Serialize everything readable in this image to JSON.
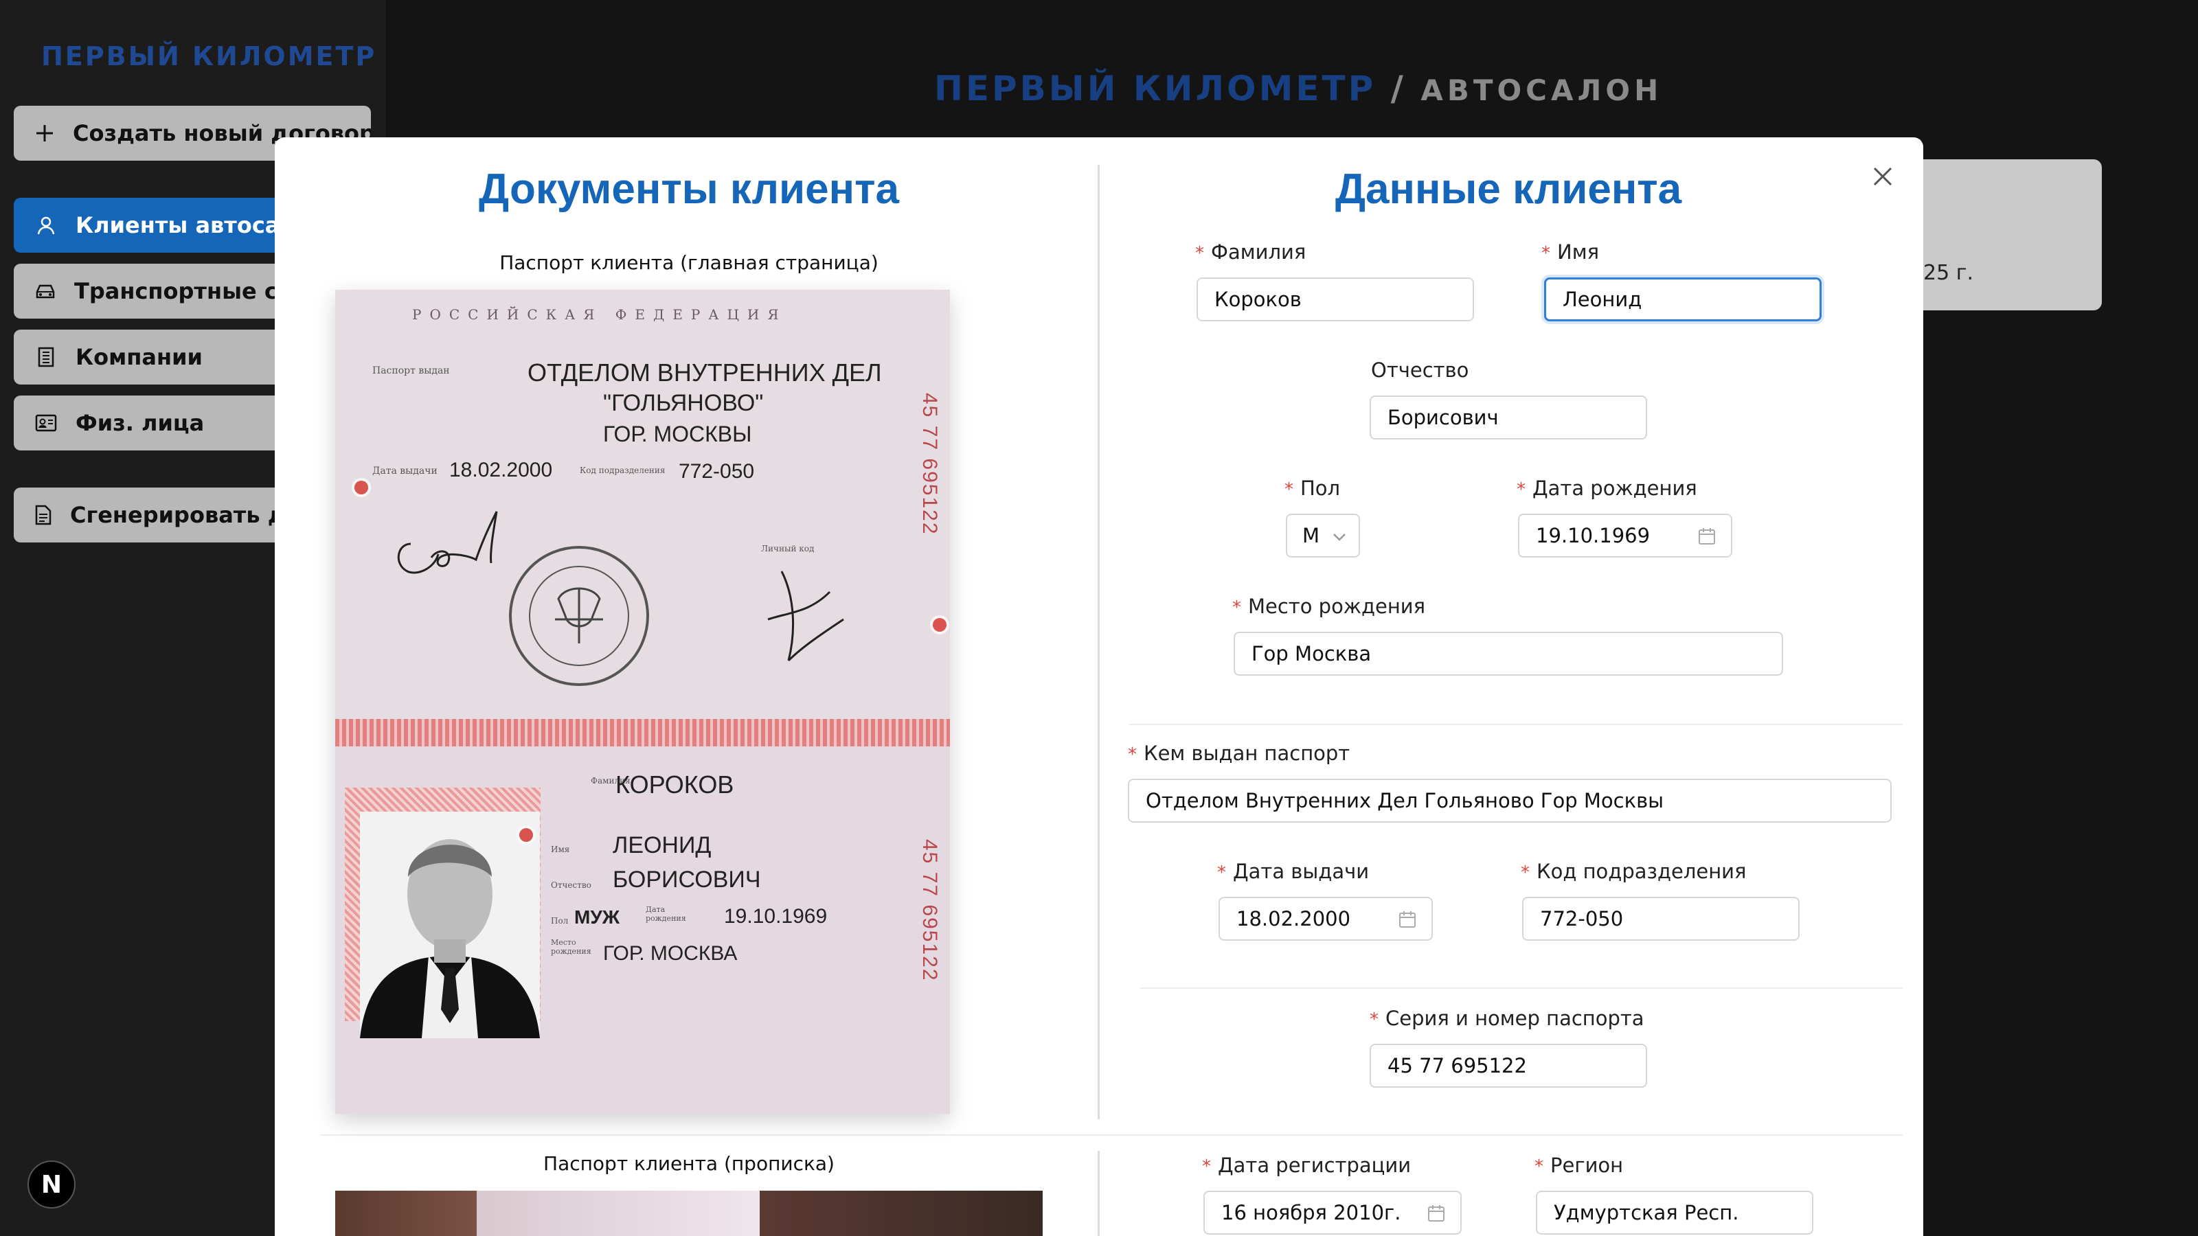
{
  "app": {
    "logo": "ПЕРВЫЙ КИЛОМЕТР",
    "header_left": "ПЕРВЫЙ КИЛОМЕТР",
    "header_sep": " / ",
    "header_right": "АВТОСАЛОН",
    "next_badge": "N",
    "bg_card_text": "25 г."
  },
  "sidebar": {
    "create_button": "Создать новый договор",
    "items": [
      {
        "label": "Клиенты автосалона",
        "icon": "user-icon",
        "active": true
      },
      {
        "label": "Транспортные средства",
        "icon": "car-icon"
      },
      {
        "label": "Компании",
        "icon": "building-icon"
      },
      {
        "label": "Физ. лица",
        "icon": "id-card-icon"
      }
    ],
    "generate_button": "Сгенерировать договор"
  },
  "modal": {
    "documents_title": "Документы клиента",
    "data_title": "Данные клиента",
    "passport_main_caption": "Паспорт клиента (главная страница)",
    "passport_reg_caption": "Паспорт клиента (прописка)"
  },
  "passport_image": {
    "country": "РОССИЙСКАЯ ФЕДЕРАЦИЯ",
    "issued_by_label": "Паспорт выдан",
    "issued_by_1": "ОТДЕЛОМ ВНУТРЕННИХ ДЕЛ",
    "issued_by_2": "\"ГОЛЬЯНОВО\"",
    "issued_by_3": "ГОР. МОСКВЫ",
    "issue_date_label": "Дата выдачи",
    "issue_date": "18.02.2000",
    "code_label": "Код подразделения",
    "code": "772-050",
    "signature_label": "Личный код",
    "surname_label": "Фамилия",
    "surname": "КОРОКОВ",
    "name_label": "Имя",
    "name": "ЛЕОНИД",
    "patronymic_label": "Отчество",
    "patronymic": "БОРИСОВИЧ",
    "sex_label": "Пол",
    "sex": "МУЖ",
    "birth_label": "Дата рождения",
    "birth_date": "19.10.1969",
    "place_label": "Место рождения",
    "place": "ГОР. МОСКВА",
    "series_number": "45 77 695122"
  },
  "form": {
    "surname": {
      "label": "Фамилия",
      "value": "Короков"
    },
    "name": {
      "label": "Имя",
      "value": "Леонид"
    },
    "patronymic": {
      "label": "Отчество",
      "value": "Борисович"
    },
    "sex": {
      "label": "Пол",
      "value": "М"
    },
    "birth_date": {
      "label": "Дата рождения",
      "value": "19.10.1969"
    },
    "birth_place": {
      "label": "Место рождения",
      "value": "Гор Москва"
    },
    "issued_by": {
      "label": "Кем выдан паспорт",
      "value": "Отделом Внутренних Дел Гольяново Гор Москвы"
    },
    "issue_date": {
      "label": "Дата выдачи",
      "value": "18.02.2000"
    },
    "division_code": {
      "label": "Код подразделения",
      "value": "772-050"
    },
    "passport_number": {
      "label": "Серия и номер паспорта",
      "value": "45 77 695122"
    },
    "registration_date": {
      "label": "Дата регистрации",
      "value": "16 ноября 2010г."
    },
    "region": {
      "label": "Регион",
      "value": "Удмуртская Респ."
    }
  }
}
